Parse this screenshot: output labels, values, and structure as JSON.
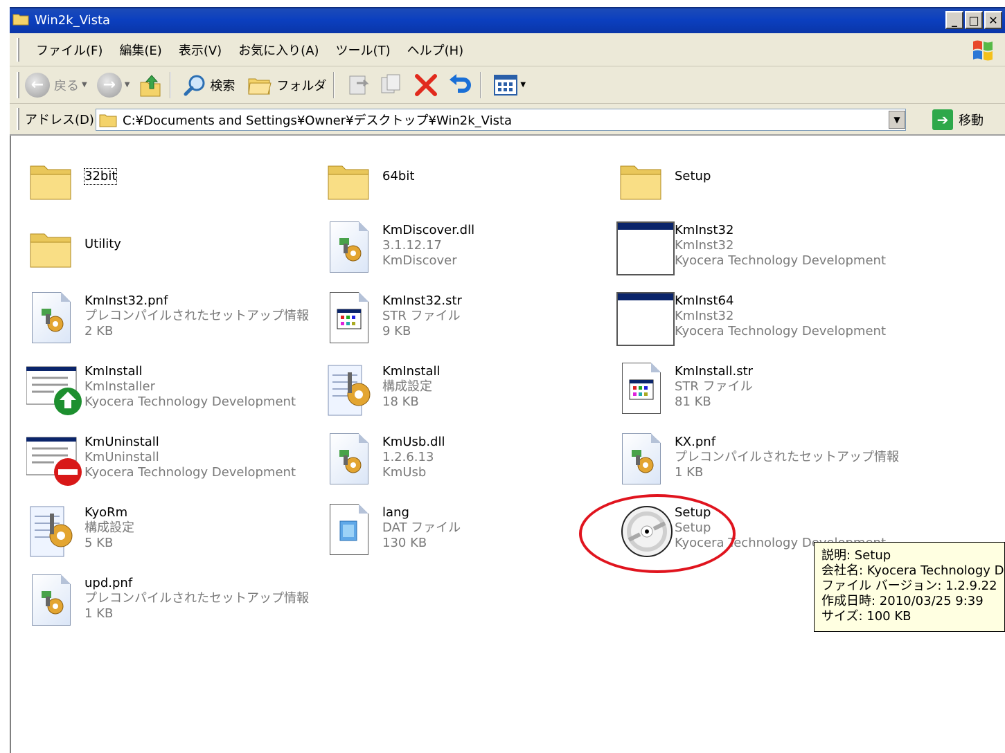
{
  "window": {
    "title": "Win2k_Vista",
    "buttons": [
      "_",
      "□",
      "✕"
    ]
  },
  "menu": [
    "ファイル(F)",
    "編集(E)",
    "表示(V)",
    "お気に入り(A)",
    "ツール(T)",
    "ヘルプ(H)"
  ],
  "toolbar": {
    "back": "戻る",
    "search": "検索",
    "folders": "フォルダ"
  },
  "address": {
    "label": "アドレス(D)",
    "path": "C:¥Documents and Settings¥Owner¥デスクトップ¥Win2k_Vista",
    "go": "移動"
  },
  "files": [
    {
      "icon": "folder-icon",
      "name": "32bit",
      "lines": []
    },
    {
      "icon": "folder-icon",
      "name": "64bit",
      "lines": []
    },
    {
      "icon": "folder-icon",
      "name": "Setup",
      "lines": []
    },
    {
      "icon": "folder-icon",
      "name": "Utility",
      "lines": []
    },
    {
      "icon": "dll-icon",
      "name": "KmDiscover.dll",
      "lines": [
        "3.1.12.17",
        "KmDiscover"
      ]
    },
    {
      "icon": "application-icon",
      "name": "KmInst32",
      "lines": [
        "KmInst32",
        "Kyocera Technology Development"
      ]
    },
    {
      "icon": "setup-info-icon",
      "name": "KmInst32.pnf",
      "lines": [
        "プレコンパイルされたセットアップ情報",
        "2 KB"
      ]
    },
    {
      "icon": "str-file-icon",
      "name": "KmInst32.str",
      "lines": [
        "STR ファイル",
        "9 KB"
      ]
    },
    {
      "icon": "application-icon",
      "name": "KmInst64",
      "lines": [
        "KmInst32",
        "Kyocera Technology Development"
      ]
    },
    {
      "icon": "installer-icon",
      "name": "KmInstall",
      "lines": [
        "KmInstaller",
        "Kyocera Technology Development"
      ]
    },
    {
      "icon": "config-icon",
      "name": "KmInstall",
      "lines": [
        "構成設定",
        "18 KB"
      ]
    },
    {
      "icon": "str-file-icon",
      "name": "KmInstall.str",
      "lines": [
        "STR ファイル",
        "81 KB"
      ]
    },
    {
      "icon": "uninstaller-icon",
      "name": "KmUninstall",
      "lines": [
        "KmUninstall",
        "Kyocera Technology Development"
      ]
    },
    {
      "icon": "dll-icon",
      "name": "KmUsb.dll",
      "lines": [
        "1.2.6.13",
        "KmUsb"
      ]
    },
    {
      "icon": "setup-info-icon",
      "name": "KX.pnf",
      "lines": [
        "プレコンパイルされたセットアップ情報",
        "1 KB"
      ]
    },
    {
      "icon": "config-icon",
      "name": "KyoRm",
      "lines": [
        "構成設定",
        "5 KB"
      ]
    },
    {
      "icon": "dat-file-icon",
      "name": "lang",
      "lines": [
        "DAT ファイル",
        "130 KB"
      ]
    },
    {
      "icon": "cd-setup-icon",
      "name": "Setup",
      "lines": [
        "Setup",
        "Kyocera Technology Development"
      ]
    },
    {
      "icon": "setup-info-icon",
      "name": "upd.pnf",
      "lines": [
        "プレコンパイルされたセットアップ情報",
        "1 KB"
      ]
    }
  ],
  "tooltip": [
    "説明: Setup",
    "会社名: Kyocera Technology Development",
    "ファイル バージョン: 1.2.9.22",
    "作成日時: 2010/03/25 9:39",
    "サイズ: 100 KB"
  ]
}
